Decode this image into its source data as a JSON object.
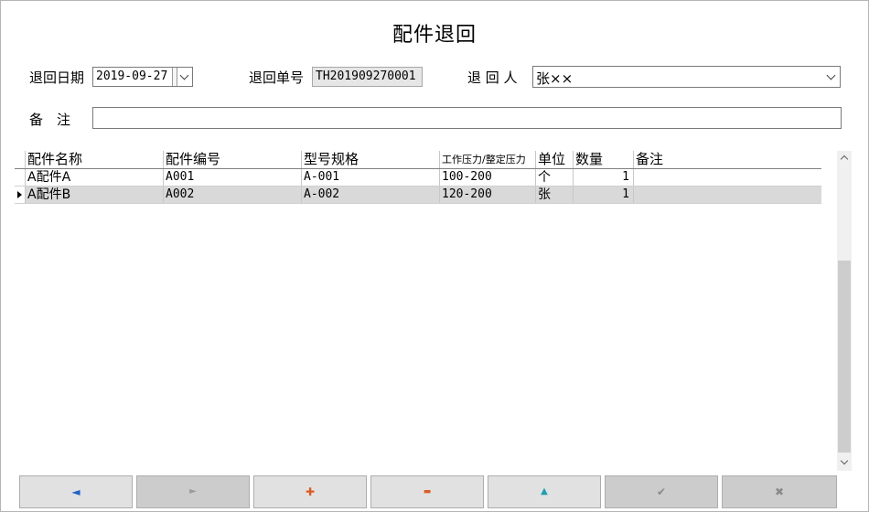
{
  "window": {
    "title": "配件退回"
  },
  "form": {
    "return_date_label": "退回日期",
    "return_date_value": "2019-09-27",
    "return_no_label": "退回单号",
    "return_no_value": "TH201909270001",
    "returner_label": "退 回 人",
    "returner_value": "张××",
    "remark_label": "备　注",
    "remark_value": ""
  },
  "grid": {
    "columns": [
      "配件名称",
      "配件编号",
      "型号规格",
      "工作压力/整定压力",
      "单位",
      "数量",
      "备注"
    ],
    "rows": [
      {
        "name": "A配件A",
        "code": "A001",
        "model": "A-001",
        "pressure": "100-200",
        "unit": "个",
        "qty": "1",
        "remark": "",
        "selected": false
      },
      {
        "name": "A配件B",
        "code": "A002",
        "model": "A-002",
        "pressure": "120-200",
        "unit": "张",
        "qty": "1",
        "remark": "",
        "selected": true
      }
    ]
  },
  "toolbar": {
    "buttons": [
      {
        "icon": "arrow-left-icon",
        "glyph": "◄",
        "color": "#1e64c8",
        "enabled": true
      },
      {
        "icon": "arrow-right-icon",
        "glyph": "►",
        "color": "#9a9a9a",
        "enabled": false
      },
      {
        "icon": "plus-icon",
        "glyph": "✚",
        "color": "#e05a1e",
        "enabled": true
      },
      {
        "icon": "minus-icon",
        "glyph": "▬",
        "color": "#e05a1e",
        "enabled": true
      },
      {
        "icon": "triangle-up-icon",
        "glyph": "▲",
        "color": "#1aa0b4",
        "enabled": true
      },
      {
        "icon": "check-icon",
        "glyph": "✔",
        "color": "#8a8a8a",
        "enabled": false
      },
      {
        "icon": "close-icon",
        "glyph": "✖",
        "color": "#8a8a8a",
        "enabled": false
      }
    ]
  },
  "colors": {
    "selected_row": "#d9d9d9",
    "readonly_field": "#e6e6e6",
    "button_face": "#e1e1e1"
  }
}
